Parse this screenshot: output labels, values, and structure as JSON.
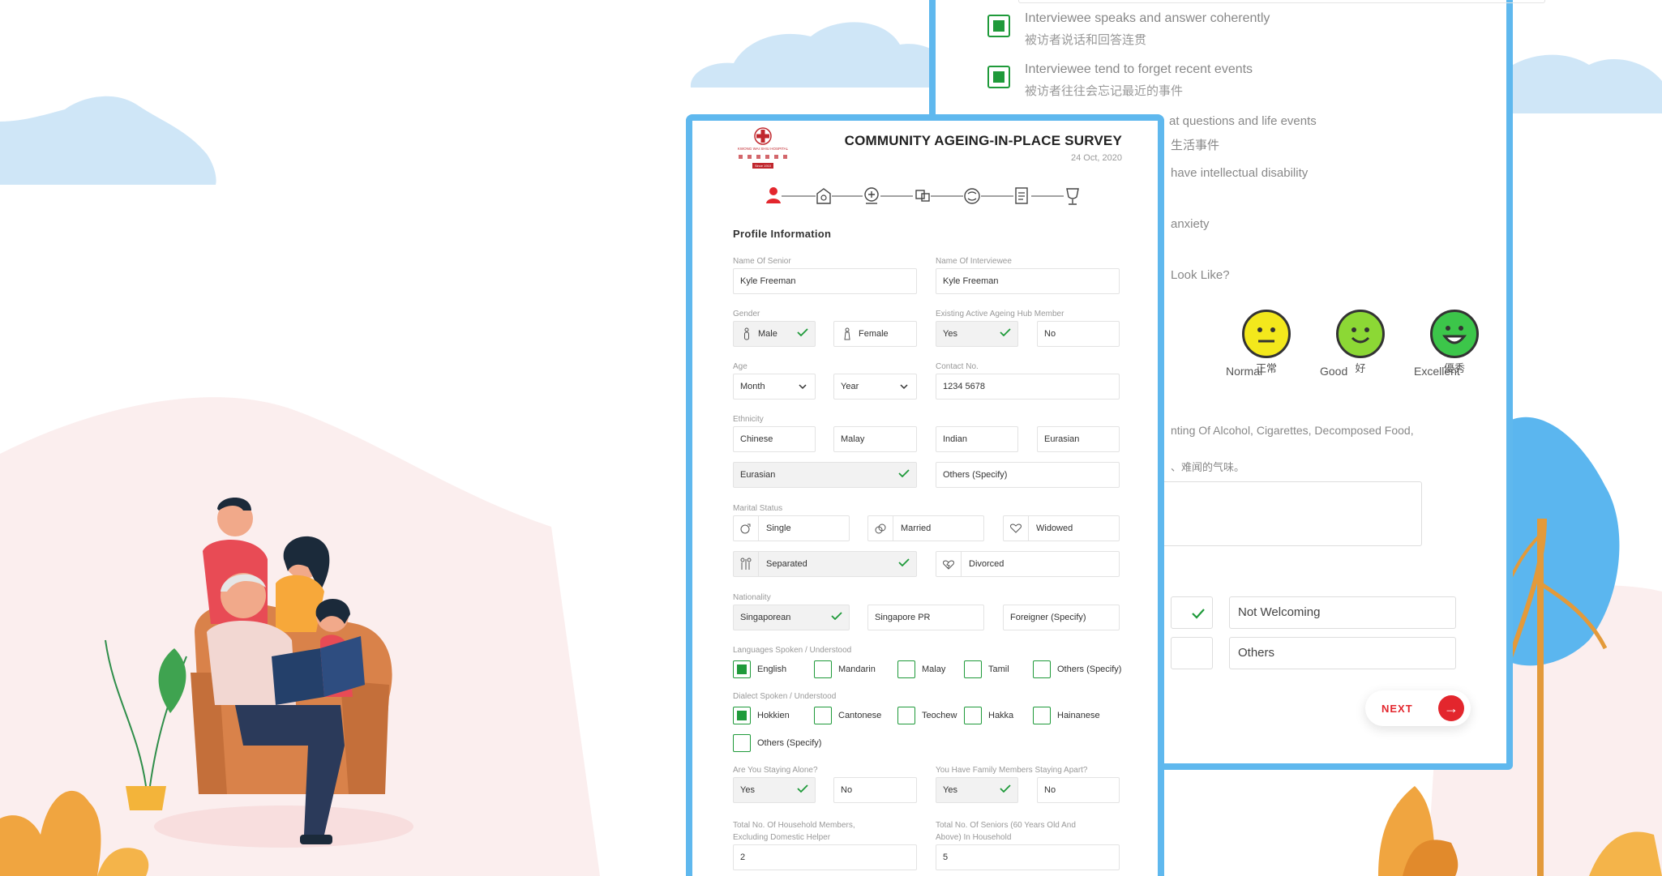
{
  "survey": {
    "title": "COMMUNITY AGEING-IN-PLACE SURVEY",
    "date": "24 Oct, 2020",
    "org_name": "KWONG WAI SHIU HOSPITAL",
    "org_since": "Since 1910",
    "section_title": "Profile Information",
    "steps": [
      "user-icon",
      "home-care-icon",
      "health-icon",
      "social-icon",
      "brain-icon",
      "document-icon",
      "trophy-icon"
    ],
    "active_step": 0
  },
  "form": {
    "name_of_senior": {
      "label": "Name Of Senior",
      "value": "Kyle Freeman"
    },
    "name_of_interviewee": {
      "label": "Name Of Interviewee",
      "value": "Kyle Freeman"
    },
    "gender": {
      "label": "Gender",
      "options": [
        "Male",
        "Female"
      ],
      "selected": "Male"
    },
    "hub_member": {
      "label": "Existing Active Ageing Hub Member",
      "options": [
        "Yes",
        "No"
      ],
      "selected": "Yes"
    },
    "age": {
      "label": "Age",
      "month": "Month",
      "year": "Year"
    },
    "contact": {
      "label": "Contact No.",
      "value": "1234 5678"
    },
    "ethnicity": {
      "label": "Ethnicity",
      "options": [
        "Chinese",
        "Malay",
        "Indian",
        "Eurasian"
      ],
      "selected_value": "Eurasian",
      "others": "Others (Specify)"
    },
    "marital_status": {
      "label": "Marital Status",
      "options": [
        "Single",
        "Married",
        "Widowed",
        "Separated",
        "Divorced"
      ],
      "selected": "Separated"
    },
    "nationality": {
      "label": "Nationality",
      "options": [
        "Singaporean",
        "Singapore PR",
        "Foreigner (Specify)"
      ],
      "selected": "Singaporean"
    },
    "languages": {
      "label": "Languages Spoken /  Understood",
      "options": [
        "English",
        "Mandarin",
        "Malay",
        "Tamil",
        "Others (Specify)"
      ],
      "checked": [
        "English"
      ]
    },
    "dialects": {
      "label": "Dialect Spoken / Understood",
      "options": [
        "Hokkien",
        "Cantonese",
        "Teochew",
        "Hakka",
        "Hainanese",
        "Others (Specify)"
      ],
      "checked": [
        "Hokkien"
      ]
    },
    "staying_alone": {
      "label": "Are You Staying Alone?",
      "options": [
        "Yes",
        "No"
      ],
      "selected": "Yes"
    },
    "family_apart": {
      "label": "You Have Family Members Staying Apart?",
      "options": [
        "Yes",
        "No"
      ],
      "selected": "Yes"
    },
    "household_members": {
      "label_line1": "Total No. Of Household Members,",
      "label_line2": "Excluding Domestic Helper",
      "value": "2"
    },
    "seniors_in_household": {
      "label_line1": "Total No. Of Seniors (60 Years Old And",
      "label_line2": "Above) In Household",
      "value": "5"
    }
  },
  "back_page": {
    "items": [
      {
        "en": "Interviewee speaks and answer coherently",
        "cn": "被访者说话和回答连贯",
        "checked": true
      },
      {
        "en": "Interviewee tend to forget recent events",
        "cn": "被访者往往会忘记最近的事件",
        "checked": true
      }
    ],
    "fragments": {
      "f1_en": "at questions and life events",
      "f1_cn": "生活事件",
      "f2": "have intellectual disability",
      "f3": "anxiety",
      "f4": "Look Like?",
      "f5": "nting Of Alcohol, Cigarettes, Decomposed Food,",
      "f6": "、难闻的气味。"
    },
    "moods": [
      {
        "en": "Normal",
        "cn": "正常",
        "color": "#f3e81c",
        "icon": "neutral-face-icon"
      },
      {
        "en": "Good",
        "cn": "好",
        "color": "#8cd835",
        "icon": "smile-face-icon"
      },
      {
        "en": "Excellent",
        "cn": "優秀",
        "color": "#3cc64a",
        "icon": "grin-face-icon"
      }
    ],
    "options": [
      "Not Welcoming",
      "Others"
    ],
    "next_label": "NEXT"
  },
  "colors": {
    "accent_blue": "#5fb8ee",
    "check_green": "#1f9a3a",
    "brand_red": "#e3262d"
  }
}
